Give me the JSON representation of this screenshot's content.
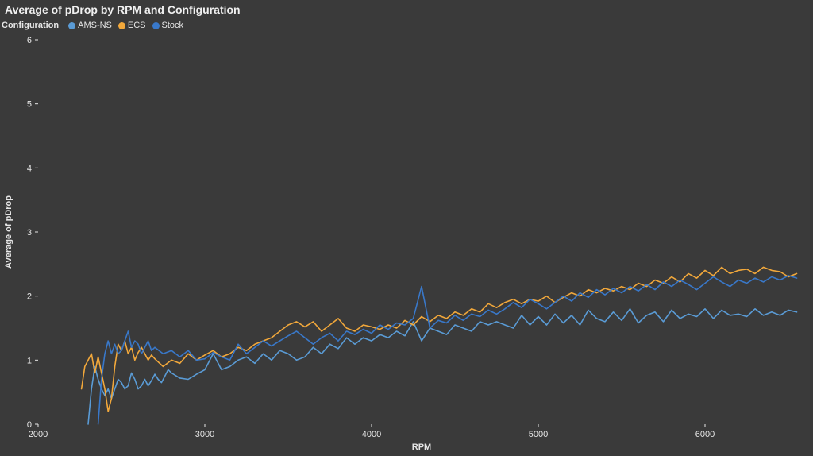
{
  "chart_data": {
    "type": "line",
    "title": "Average of pDrop by RPM and Configuration",
    "xlabel": "RPM",
    "ylabel": "Average of pDrop",
    "legend_title": "Configuration",
    "xlim": [
      2000,
      6600
    ],
    "ylim": [
      0,
      6
    ],
    "xticks": [
      2000,
      3000,
      4000,
      5000,
      6000
    ],
    "yticks": [
      0,
      1,
      2,
      3,
      4,
      5,
      6
    ],
    "series": [
      {
        "name": "AMS-NS",
        "color": "#5a9bd5",
        "x": [
          2300,
          2320,
          2340,
          2360,
          2380,
          2400,
          2420,
          2440,
          2460,
          2480,
          2500,
          2520,
          2540,
          2560,
          2580,
          2600,
          2620,
          2640,
          2660,
          2680,
          2700,
          2720,
          2740,
          2760,
          2780,
          2800,
          2850,
          2900,
          2950,
          3000,
          3050,
          3100,
          3150,
          3200,
          3250,
          3300,
          3350,
          3400,
          3450,
          3500,
          3550,
          3600,
          3650,
          3700,
          3750,
          3800,
          3850,
          3900,
          3950,
          4000,
          4050,
          4100,
          4150,
          4200,
          4250,
          4300,
          4350,
          4400,
          4450,
          4500,
          4550,
          4600,
          4650,
          4700,
          4750,
          4800,
          4850,
          4900,
          4950,
          5000,
          5050,
          5100,
          5150,
          5200,
          5250,
          5300,
          5350,
          5400,
          5450,
          5500,
          5550,
          5600,
          5650,
          5700,
          5750,
          5800,
          5850,
          5900,
          5950,
          6000,
          6050,
          6100,
          6150,
          6200,
          6250,
          6300,
          6350,
          6400,
          6450,
          6500,
          6550
        ],
        "y": [
          0.0,
          0.55,
          0.9,
          0.7,
          0.55,
          0.45,
          0.55,
          0.4,
          0.55,
          0.7,
          0.65,
          0.55,
          0.6,
          0.8,
          0.7,
          0.55,
          0.6,
          0.7,
          0.6,
          0.68,
          0.78,
          0.7,
          0.65,
          0.75,
          0.85,
          0.8,
          0.72,
          0.7,
          0.78,
          0.85,
          1.1,
          0.85,
          0.9,
          1.0,
          1.05,
          0.95,
          1.1,
          1.0,
          1.15,
          1.1,
          1.0,
          1.05,
          1.2,
          1.1,
          1.25,
          1.18,
          1.35,
          1.25,
          1.35,
          1.3,
          1.4,
          1.35,
          1.45,
          1.38,
          1.6,
          1.3,
          1.5,
          1.45,
          1.4,
          1.55,
          1.5,
          1.45,
          1.6,
          1.55,
          1.6,
          1.55,
          1.5,
          1.7,
          1.55,
          1.68,
          1.55,
          1.72,
          1.58,
          1.7,
          1.55,
          1.78,
          1.65,
          1.6,
          1.75,
          1.62,
          1.8,
          1.58,
          1.7,
          1.75,
          1.6,
          1.78,
          1.65,
          1.72,
          1.68,
          1.8,
          1.65,
          1.78,
          1.7,
          1.72,
          1.68,
          1.8,
          1.7,
          1.75,
          1.7,
          1.78,
          1.75
        ]
      },
      {
        "name": "ECS",
        "color": "#f2a83b",
        "x": [
          2260,
          2280,
          2300,
          2320,
          2340,
          2360,
          2380,
          2400,
          2420,
          2440,
          2460,
          2480,
          2500,
          2520,
          2540,
          2560,
          2580,
          2600,
          2620,
          2640,
          2660,
          2680,
          2700,
          2750,
          2800,
          2850,
          2900,
          2950,
          3000,
          3050,
          3100,
          3150,
          3200,
          3250,
          3300,
          3350,
          3400,
          3450,
          3500,
          3550,
          3600,
          3650,
          3700,
          3750,
          3800,
          3850,
          3900,
          3950,
          4000,
          4050,
          4100,
          4150,
          4200,
          4250,
          4300,
          4350,
          4400,
          4450,
          4500,
          4550,
          4600,
          4650,
          4700,
          4750,
          4800,
          4850,
          4900,
          4950,
          5000,
          5050,
          5100,
          5150,
          5200,
          5250,
          5300,
          5350,
          5400,
          5450,
          5500,
          5550,
          5600,
          5650,
          5700,
          5750,
          5800,
          5850,
          5900,
          5950,
          6000,
          6050,
          6100,
          6150,
          6200,
          6250,
          6300,
          6350,
          6400,
          6450,
          6500,
          6550
        ],
        "y": [
          0.55,
          0.9,
          1.0,
          1.1,
          0.8,
          1.05,
          0.8,
          0.55,
          0.2,
          0.4,
          0.9,
          1.25,
          1.15,
          1.3,
          1.1,
          1.2,
          1.0,
          1.12,
          1.2,
          1.1,
          1.0,
          1.08,
          1.02,
          0.9,
          1.0,
          0.95,
          1.1,
          1.0,
          1.08,
          1.15,
          1.05,
          1.1,
          1.2,
          1.15,
          1.25,
          1.3,
          1.35,
          1.45,
          1.55,
          1.6,
          1.52,
          1.6,
          1.45,
          1.55,
          1.65,
          1.5,
          1.45,
          1.55,
          1.52,
          1.48,
          1.55,
          1.5,
          1.62,
          1.55,
          1.68,
          1.6,
          1.7,
          1.65,
          1.75,
          1.7,
          1.8,
          1.75,
          1.88,
          1.82,
          1.9,
          1.95,
          1.88,
          1.95,
          1.92,
          2.0,
          1.9,
          1.98,
          2.05,
          2.0,
          2.1,
          2.05,
          2.12,
          2.08,
          2.15,
          2.1,
          2.2,
          2.15,
          2.25,
          2.2,
          2.3,
          2.22,
          2.35,
          2.28,
          2.4,
          2.32,
          2.45,
          2.35,
          2.4,
          2.42,
          2.35,
          2.45,
          2.4,
          2.38,
          2.3,
          2.35
        ]
      },
      {
        "name": "Stock",
        "color": "#3978c9",
        "x": [
          2360,
          2380,
          2400,
          2420,
          2440,
          2460,
          2480,
          2500,
          2520,
          2540,
          2560,
          2580,
          2600,
          2620,
          2640,
          2660,
          2680,
          2700,
          2750,
          2800,
          2850,
          2900,
          2950,
          3000,
          3050,
          3100,
          3150,
          3200,
          3250,
          3300,
          3350,
          3400,
          3450,
          3500,
          3550,
          3600,
          3650,
          3700,
          3750,
          3800,
          3850,
          3900,
          3950,
          4000,
          4050,
          4100,
          4150,
          4200,
          4250,
          4300,
          4350,
          4400,
          4450,
          4500,
          4550,
          4600,
          4650,
          4700,
          4750,
          4800,
          4850,
          4900,
          4950,
          5000,
          5050,
          5100,
          5150,
          5200,
          5250,
          5300,
          5350,
          5400,
          5450,
          5500,
          5550,
          5600,
          5650,
          5700,
          5750,
          5800,
          5850,
          5900,
          5950,
          6000,
          6050,
          6100,
          6150,
          6200,
          6250,
          6300,
          6350,
          6400,
          6450,
          6500,
          6550
        ],
        "y": [
          0.0,
          0.7,
          1.1,
          1.3,
          1.1,
          1.25,
          1.1,
          1.15,
          1.3,
          1.45,
          1.2,
          1.3,
          1.25,
          1.1,
          1.2,
          1.3,
          1.15,
          1.2,
          1.1,
          1.15,
          1.05,
          1.15,
          1.0,
          1.02,
          1.12,
          1.05,
          1.0,
          1.25,
          1.1,
          1.2,
          1.3,
          1.22,
          1.3,
          1.38,
          1.45,
          1.35,
          1.25,
          1.35,
          1.42,
          1.3,
          1.45,
          1.4,
          1.48,
          1.42,
          1.55,
          1.48,
          1.58,
          1.55,
          1.65,
          2.15,
          1.5,
          1.62,
          1.58,
          1.7,
          1.62,
          1.72,
          1.68,
          1.78,
          1.72,
          1.8,
          1.9,
          1.82,
          1.95,
          1.88,
          1.8,
          1.9,
          2.0,
          1.92,
          2.05,
          1.98,
          2.1,
          2.02,
          2.12,
          2.05,
          2.15,
          2.08,
          2.18,
          2.1,
          2.22,
          2.15,
          2.25,
          2.18,
          2.1,
          2.2,
          2.3,
          2.22,
          2.15,
          2.25,
          2.2,
          2.28,
          2.22,
          2.3,
          2.25,
          2.32,
          2.28
        ]
      }
    ]
  }
}
